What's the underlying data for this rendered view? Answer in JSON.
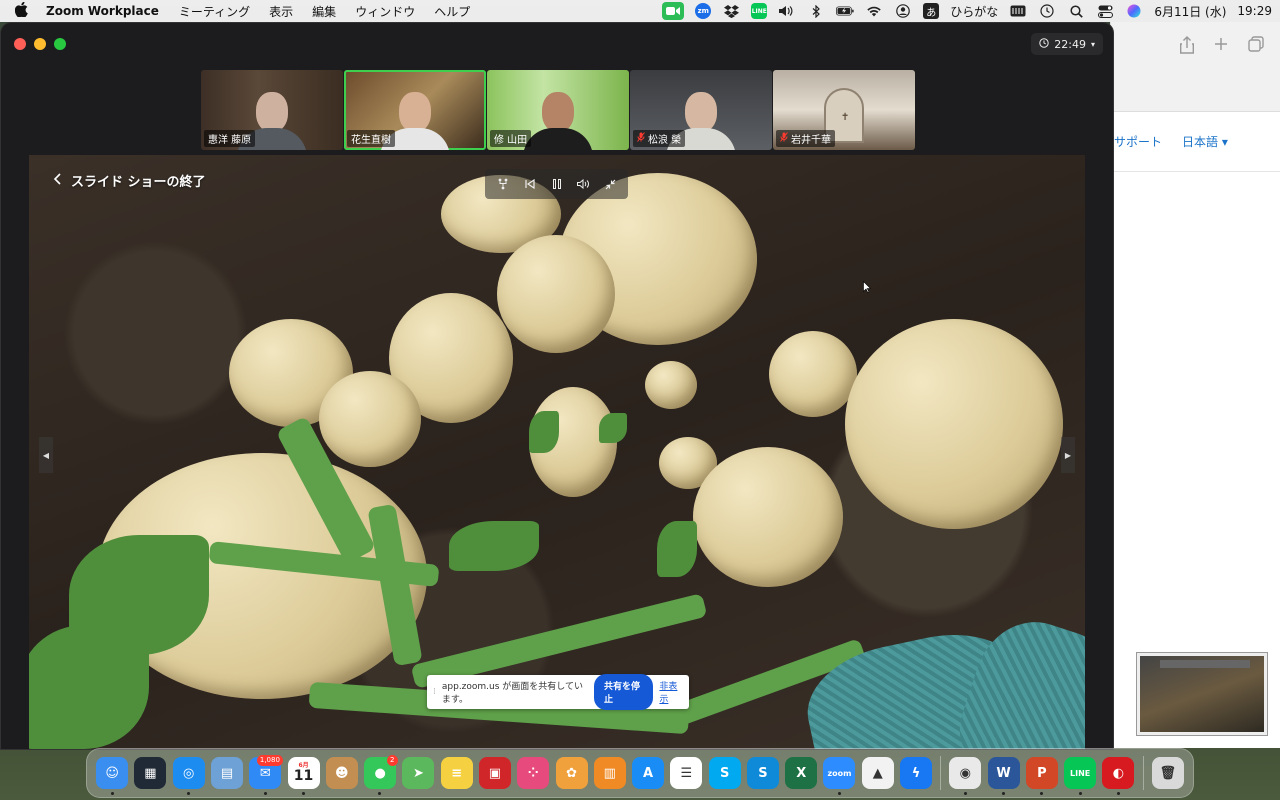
{
  "menubar": {
    "app_name": "Zoom Workplace",
    "menus": [
      "ミーティング",
      "表示",
      "編集",
      "ウィンドウ",
      "ヘルプ"
    ],
    "ime_label": "あ",
    "ime_mode": "ひらがな",
    "date": "6月11日 (水)",
    "time": "19:29",
    "zm_label": "zm",
    "line_label": "LINE"
  },
  "browser": {
    "nav_support": "サポート",
    "nav_lang": "日本語 ▾"
  },
  "zoom": {
    "timer": "22:49",
    "participants": [
      {
        "name": "惠洋 藤原",
        "muted": false,
        "active": false
      },
      {
        "name": "花生直樹",
        "muted": false,
        "active": true
      },
      {
        "name": "修 山田",
        "muted": false,
        "active": false
      },
      {
        "name": "松浪 榮",
        "muted": true,
        "active": false
      },
      {
        "name": "岩井千華",
        "muted": true,
        "active": false
      }
    ],
    "slideshow": {
      "exit_label": "スライド ショーの終了"
    },
    "share_banner": {
      "message": "app.zoom.us が画面を共有しています。",
      "stop_label": "共有を停止",
      "hide_label": "非表示"
    }
  },
  "dock": {
    "apps": [
      {
        "name": "Finder",
        "icon": "finder-icon",
        "color": "#3a8ef0",
        "glyph": "☺",
        "running": true
      },
      {
        "name": "Mission Control",
        "icon": "mission-control-icon",
        "color": "#1f2a36",
        "glyph": "▦",
        "running": false
      },
      {
        "name": "Safari",
        "icon": "safari-icon",
        "color": "#1d8cf0",
        "glyph": "◎",
        "running": true
      },
      {
        "name": "Preview",
        "icon": "preview-icon",
        "color": "#6ea1d6",
        "glyph": "▤",
        "running": false
      },
      {
        "name": "Mail",
        "icon": "mail-icon",
        "color": "#2f8af5",
        "glyph": "✉",
        "badge": "1,080",
        "running": true
      },
      {
        "name": "Calendar",
        "icon": "calendar-icon",
        "color": "#ffffff",
        "glyph": "11",
        "month": "6月",
        "running": true
      },
      {
        "name": "Contacts",
        "icon": "contacts-icon",
        "color": "#c38e52",
        "glyph": "☻",
        "running": false
      },
      {
        "name": "Messages",
        "icon": "messages-icon",
        "color": "#34c759",
        "glyph": "●",
        "badge": "2",
        "running": true
      },
      {
        "name": "Maps",
        "icon": "maps-icon",
        "color": "#5cb85c",
        "glyph": "➤",
        "running": false
      },
      {
        "name": "Notes",
        "icon": "notes-icon",
        "color": "#f5d142",
        "glyph": "≡",
        "running": false
      },
      {
        "name": "Photo Booth",
        "icon": "photo-booth-icon",
        "color": "#d0262a",
        "glyph": "▣",
        "running": false
      },
      {
        "name": "Launchpad",
        "icon": "launchpad-icon",
        "color": "#e74a7c",
        "glyph": "⁘",
        "running": false
      },
      {
        "name": "Photos",
        "icon": "photos-icon",
        "color": "#f0a13b",
        "glyph": "✿",
        "running": false
      },
      {
        "name": "Books",
        "icon": "books-icon",
        "color": "#f08a24",
        "glyph": "▥",
        "running": false
      },
      {
        "name": "App Store",
        "icon": "app-store-icon",
        "color": "#1a8cf5",
        "glyph": "A",
        "running": false
      },
      {
        "name": "Reminders",
        "icon": "reminders-icon",
        "color": "#ffffff",
        "glyph": "☰",
        "running": false
      },
      {
        "name": "Skype",
        "icon": "skype-icon",
        "color": "#00a9f0",
        "glyph": "S",
        "running": false
      },
      {
        "name": "Skype for Business",
        "icon": "skype-business-icon",
        "color": "#0e8ad8",
        "glyph": "S",
        "running": false
      },
      {
        "name": "Excel",
        "icon": "excel-icon",
        "color": "#1e7145",
        "glyph": "X",
        "running": false
      },
      {
        "name": "Zoom",
        "icon": "zoom-icon",
        "color": "#2d8cff",
        "glyph": "zoom",
        "running": true
      },
      {
        "name": "Google Drive",
        "icon": "google-drive-icon",
        "color": "#f2f2f2",
        "glyph": "▲",
        "running": false
      },
      {
        "name": "Messenger",
        "icon": "messenger-icon",
        "color": "#1877f2",
        "glyph": "ϟ",
        "running": false
      }
    ],
    "recent": [
      {
        "name": "Chrome",
        "icon": "chrome-icon",
        "color": "#e9e9e9",
        "glyph": "◉",
        "running": true
      },
      {
        "name": "Word",
        "icon": "word-icon",
        "color": "#2b579a",
        "glyph": "W",
        "running": true
      },
      {
        "name": "PowerPoint",
        "icon": "powerpoint-icon",
        "color": "#d24726",
        "glyph": "P",
        "running": true
      },
      {
        "name": "LINE",
        "icon": "line-icon",
        "color": "#06c755",
        "glyph": "LINE",
        "running": true
      },
      {
        "name": "Trend Micro",
        "icon": "trend-micro-icon",
        "color": "#d71920",
        "glyph": "◐",
        "running": true
      }
    ],
    "trash": {
      "name": "Trash",
      "icon": "trash-icon",
      "color": "#d9d9d9",
      "glyph": "🗑"
    }
  }
}
